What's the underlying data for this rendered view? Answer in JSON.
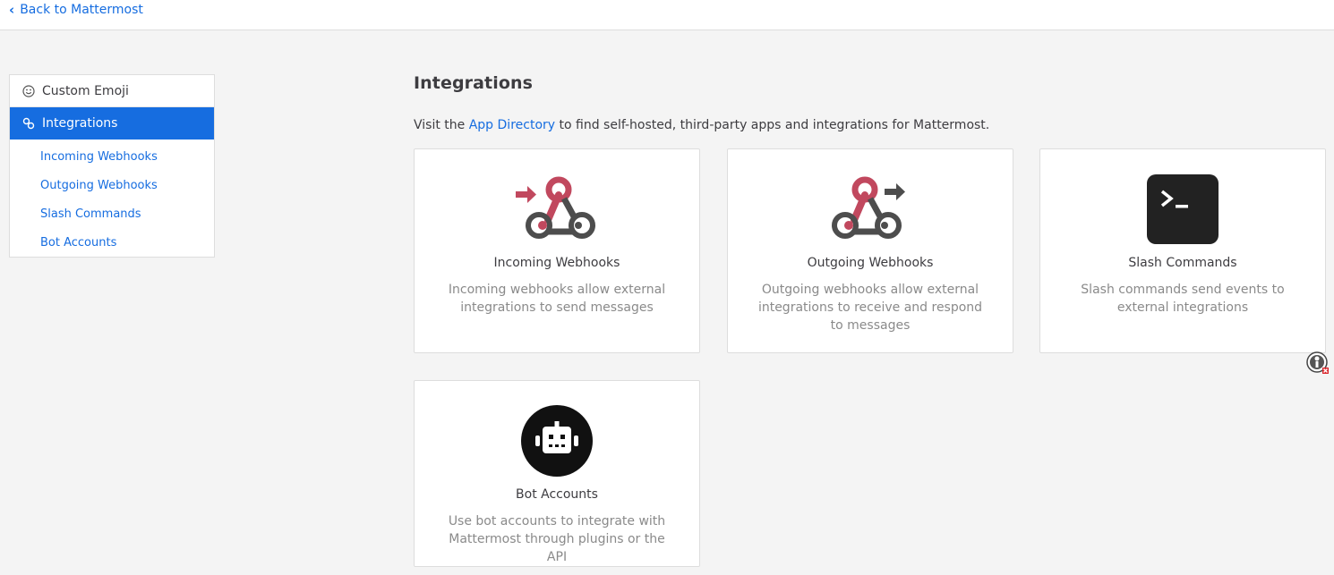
{
  "topbar": {
    "back_label": "Back to Mattermost"
  },
  "sidebar": {
    "custom_emoji": "Custom Emoji",
    "integrations": "Integrations",
    "items": [
      {
        "label": "Incoming Webhooks"
      },
      {
        "label": "Outgoing Webhooks"
      },
      {
        "label": "Slash Commands"
      },
      {
        "label": "Bot Accounts"
      }
    ]
  },
  "main": {
    "title": "Integrations",
    "intro_before": "Visit the ",
    "intro_link": "App Directory",
    "intro_after": " to find self-hosted, third-party apps and integrations for Mattermost.",
    "cards": [
      {
        "icon": "incoming-webhook-icon",
        "title": "Incoming Webhooks",
        "desc": "Incoming webhooks allow external integrations to send messages"
      },
      {
        "icon": "outgoing-webhook-icon",
        "title": "Outgoing Webhooks",
        "desc": "Outgoing webhooks allow external integrations to receive and respond to messages"
      },
      {
        "icon": "terminal-icon",
        "title": "Slash Commands",
        "desc": "Slash commands send events to external integrations"
      },
      {
        "icon": "bot-icon",
        "title": "Bot Accounts",
        "desc": "Use bot accounts to integrate with Mattermost through plugins or the API"
      }
    ]
  },
  "colors": {
    "accent": "#166de0",
    "webhook_red": "#c1485e",
    "webhook_gray": "#4d4d4d"
  }
}
